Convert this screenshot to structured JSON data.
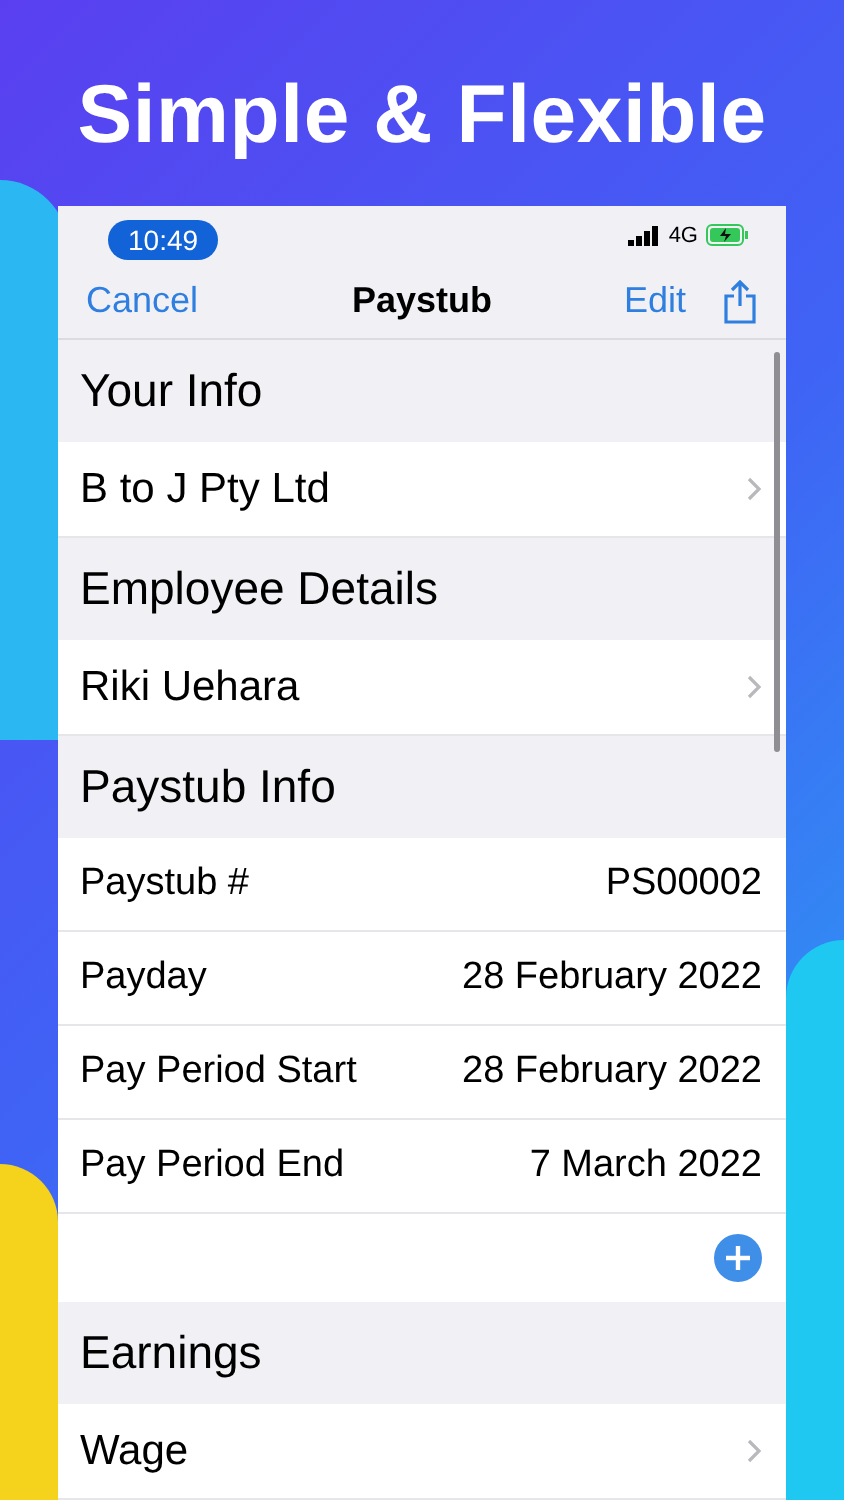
{
  "headline": "Simple & Flexible",
  "status_bar": {
    "time": "10:49",
    "network": "4G"
  },
  "nav": {
    "left": "Cancel",
    "title": "Paystub",
    "right": "Edit"
  },
  "sections": [
    {
      "title": "Your Info",
      "rows": [
        {
          "kind": "link",
          "label": "B to J Pty Ltd"
        }
      ]
    },
    {
      "title": "Employee Details",
      "rows": [
        {
          "kind": "link",
          "label": "Riki Uehara"
        }
      ]
    },
    {
      "title": "Paystub Info",
      "rows": [
        {
          "kind": "field",
          "label": "Paystub #",
          "value": "PS00002"
        },
        {
          "kind": "field",
          "label": "Payday",
          "value": "28 February 2022"
        },
        {
          "kind": "field",
          "label": "Pay Period Start",
          "value": "28 February 2022"
        },
        {
          "kind": "field",
          "label": "Pay Period End",
          "value": "7 March 2022"
        },
        {
          "kind": "add"
        }
      ]
    },
    {
      "title": "Earnings",
      "rows": [
        {
          "kind": "link",
          "label": "Wage"
        }
      ]
    }
  ]
}
